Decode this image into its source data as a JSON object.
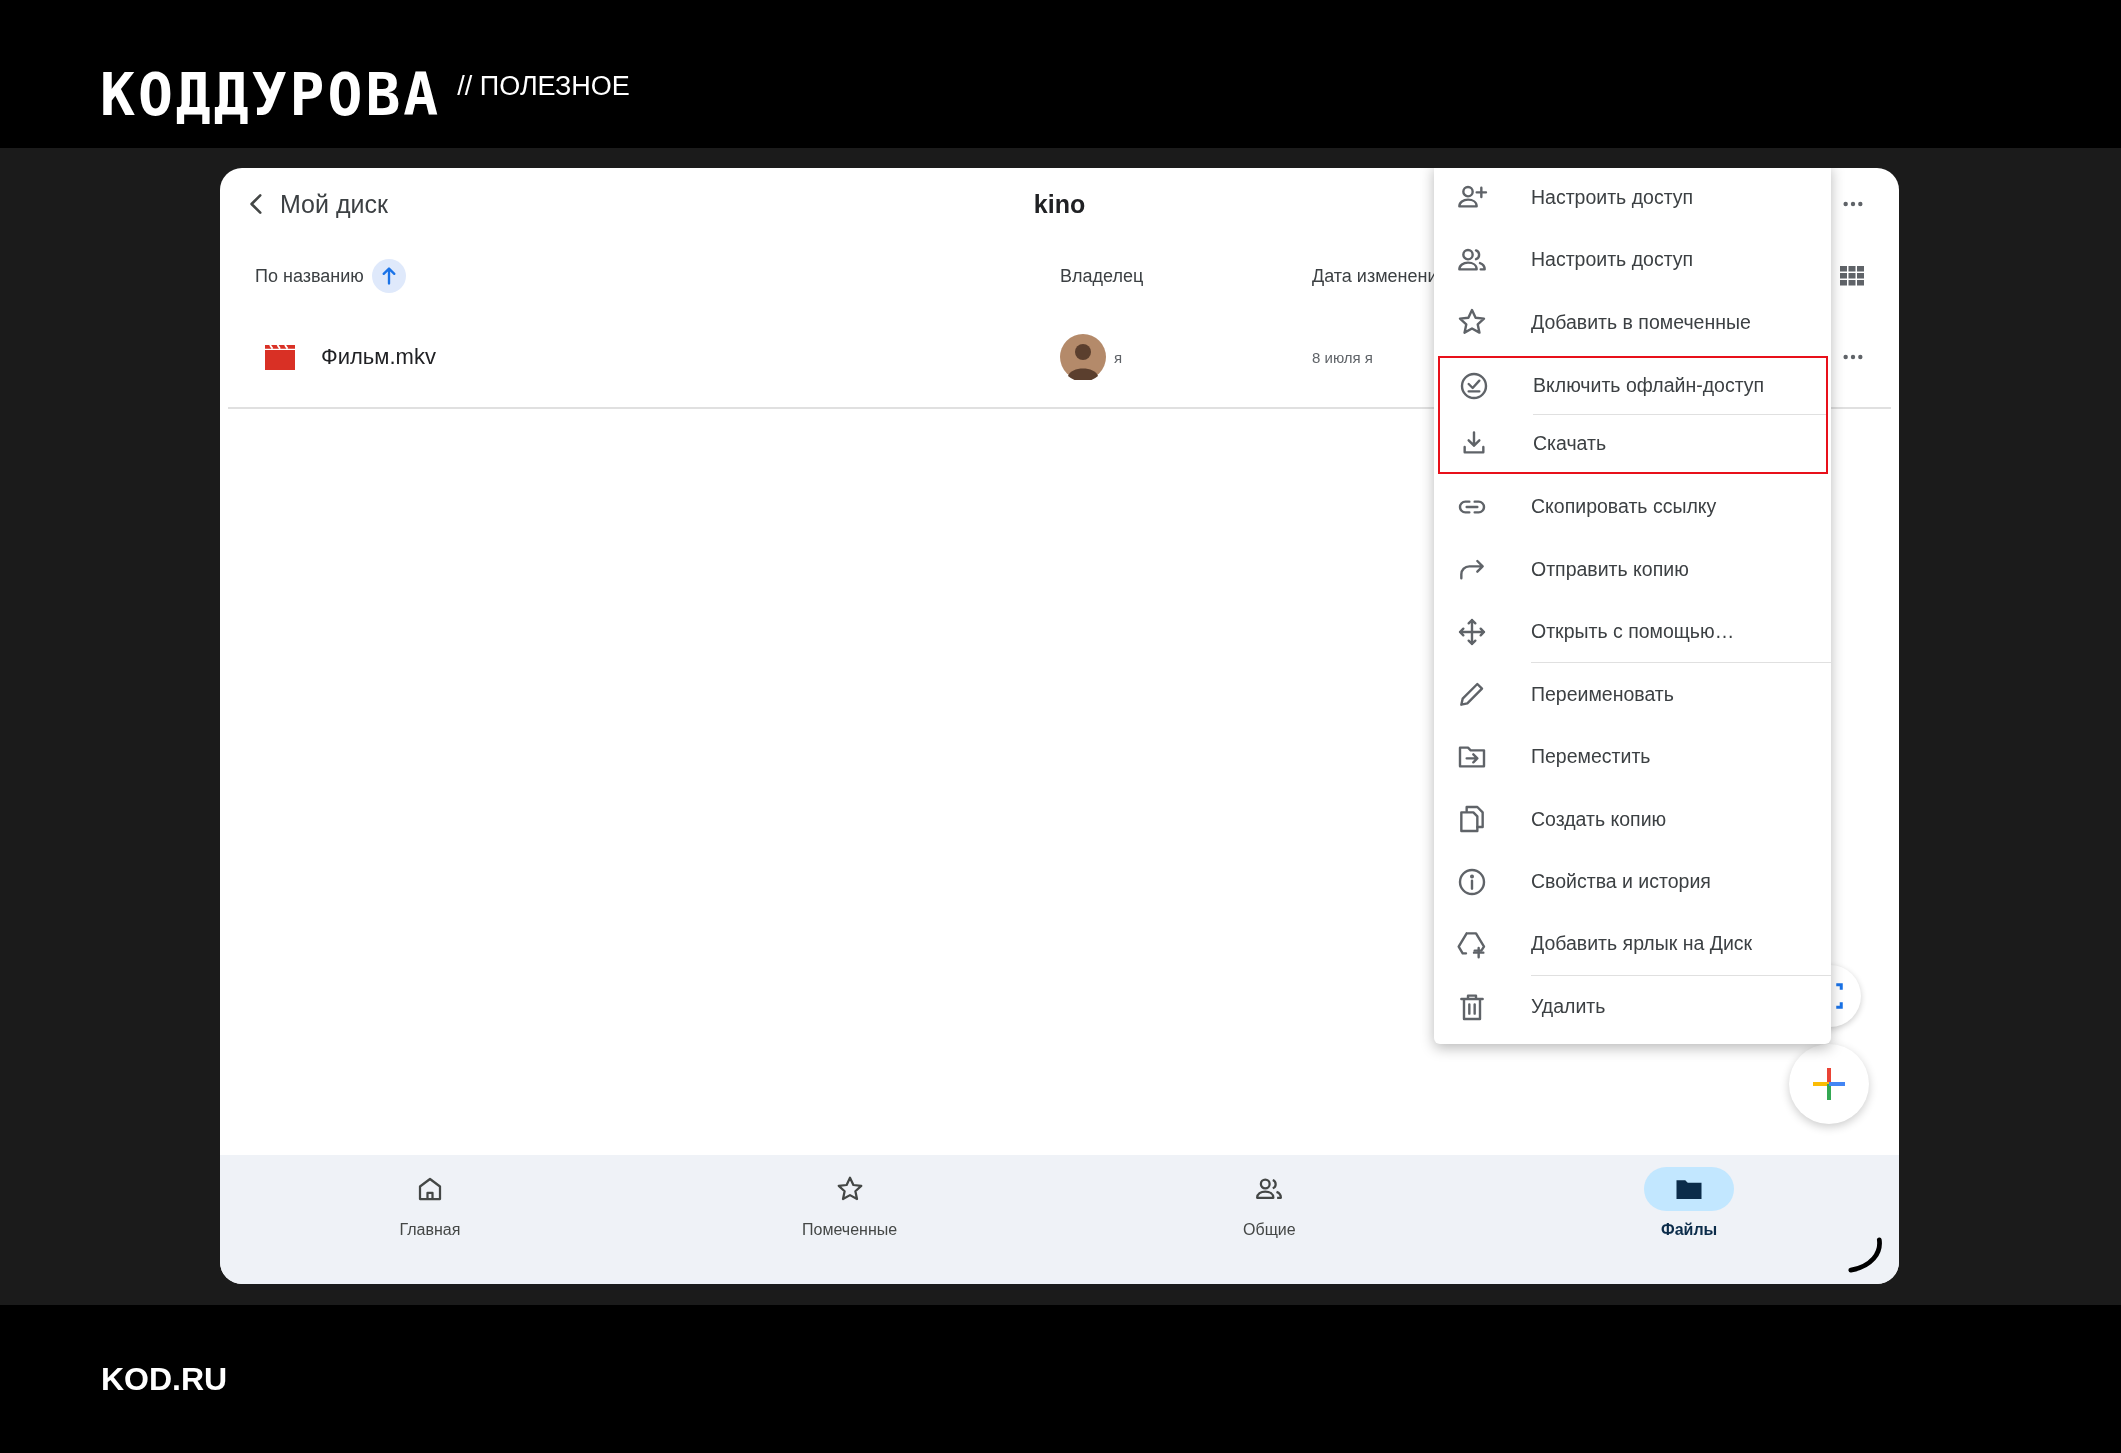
{
  "brand": {
    "logo": "КОДДУРОВА",
    "section": "// ПОЛЕЗНОЕ",
    "footer": "KOD.RU"
  },
  "app": {
    "back": "Мой диск",
    "title": "kino",
    "columns": [
      {
        "label": "По названию",
        "sorted": true
      },
      {
        "label": "Владелец",
        "sorted": false
      },
      {
        "label": "Дата изменени",
        "sorted": false
      }
    ],
    "rows": [
      {
        "name": "Фильм.mkv",
        "owner": "я",
        "modified": "8 июля я"
      }
    ],
    "menu": [
      {
        "label": "Настроить доступ",
        "highlighted": false,
        "separator_after": false
      },
      {
        "label": "Настроить доступ",
        "highlighted": false,
        "separator_after": false
      },
      {
        "label": "Добавить в помеченные",
        "highlighted": false,
        "separator_after": false
      },
      {
        "label": "Включить офлайн-доступ",
        "highlighted": true,
        "separator_after": true
      },
      {
        "label": "Скачать",
        "highlighted": true,
        "separator_after": false
      },
      {
        "label": "Скопировать ссылку",
        "highlighted": false,
        "separator_after": false
      },
      {
        "label": "Отправить копию",
        "highlighted": false,
        "separator_after": false
      },
      {
        "label": "Открыть с помощью…",
        "highlighted": false,
        "separator_after": true
      },
      {
        "label": "Переименовать",
        "highlighted": false,
        "separator_after": false
      },
      {
        "label": "Переместить",
        "highlighted": false,
        "separator_after": false
      },
      {
        "label": "Создать копию",
        "highlighted": false,
        "separator_after": false
      },
      {
        "label": "Свойства и история",
        "highlighted": false,
        "separator_after": false
      },
      {
        "label": "Добавить ярлык на Диск",
        "highlighted": false,
        "separator_after": true
      },
      {
        "label": "Удалить",
        "highlighted": false,
        "separator_after": false
      }
    ],
    "nav": [
      {
        "label": "Главная",
        "selected": false
      },
      {
        "label": "Помеченные",
        "selected": false
      },
      {
        "label": "Общие",
        "selected": false
      },
      {
        "label": "Файлы",
        "selected": true
      }
    ]
  }
}
